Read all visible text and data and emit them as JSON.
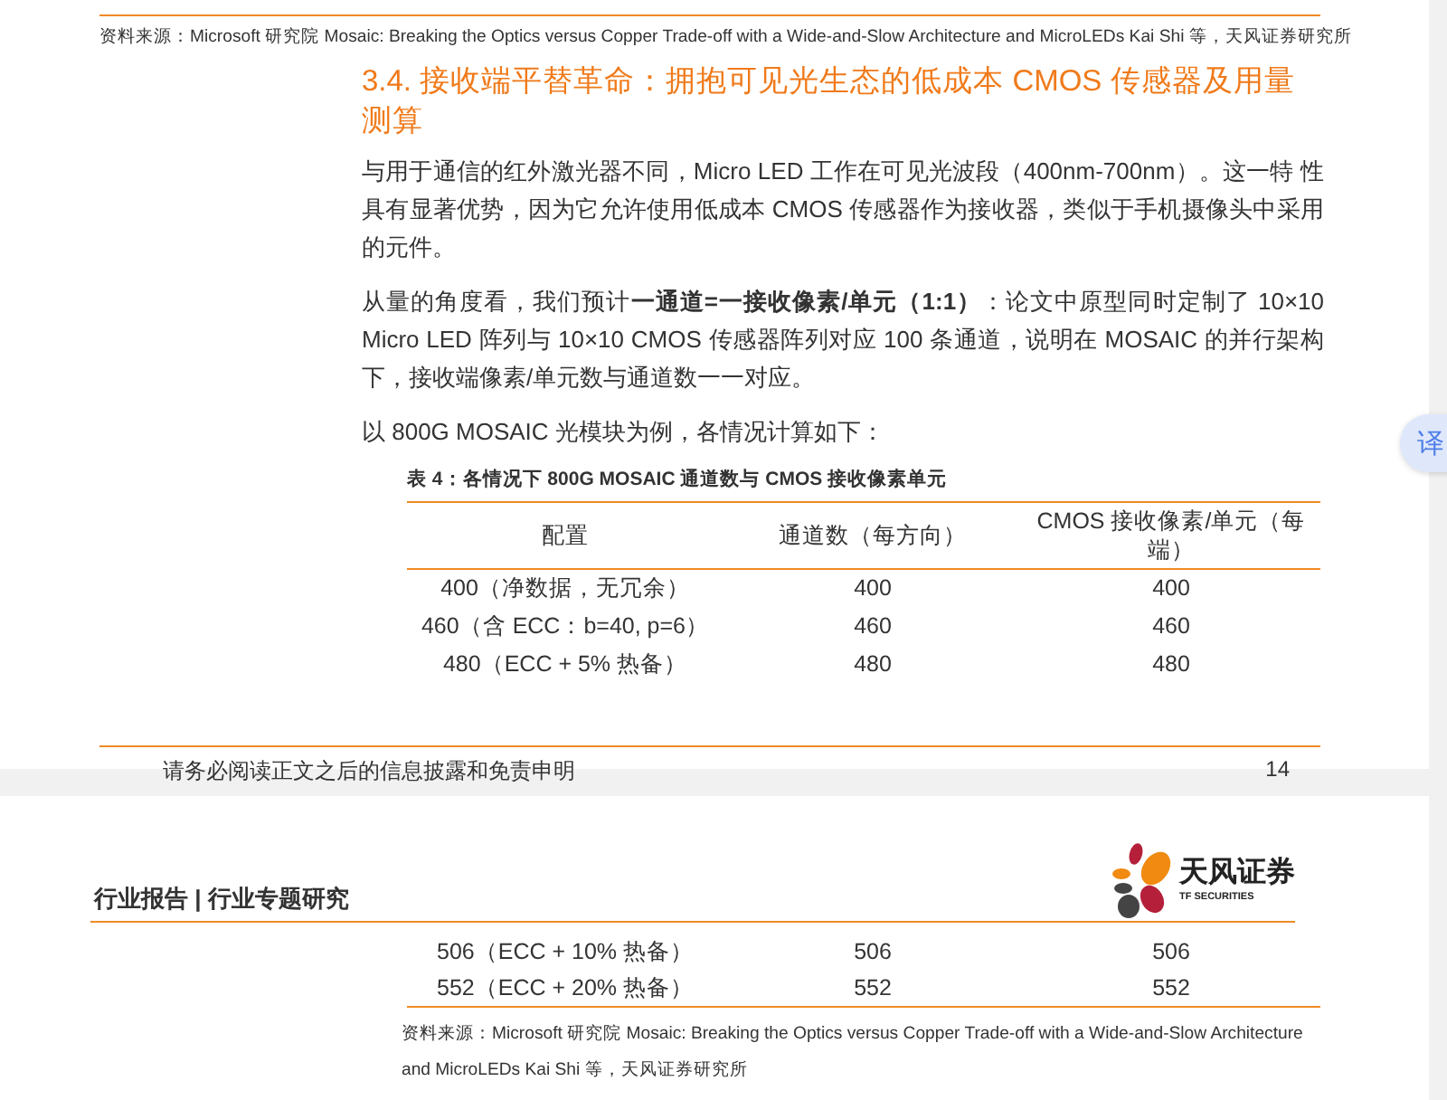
{
  "page_top": {
    "source_note": "资料来源：Microsoft 研究院 Mosaic:  Breaking the Optics versus Copper Trade-off with a Wide-and-Slow Architecture and MicroLEDs Kai Shi 等，天风证券研究所",
    "section_heading": "3.4. 接收端平替革命：拥抱可见光生态的低成本 CMOS 传感器及用量测算",
    "paragraphs": [
      "与用于通信的红外激光器不同，Micro  LED 工作在可见光波段（400nm-700nm）。这一特 性具有显著优势，因为它允许使用低成本 CMOS 传感器作为接收器，类似于手机摄像头中采用的元件。",
      "从量的角度看，我们预计**一通道=一接收像素/单元（1:1）**：论文中原型同时定制了 10×10 Micro LED 阵列与 10×10 CMOS 传感器阵列对应 100 条通道，说明在 MOSAIC 的并行架构下，接收端像素/单元数与通道数一一对应。",
      "以 800G MOSAIC 光模块为例，各情况计算如下："
    ],
    "table": {
      "caption": "表 4：各情况下 800G MOSAIC 通道数与 CMOS 接收像素单元",
      "columns": [
        "配置",
        "通道数（每方向）",
        "CMOS 接收像素/单元（每端）"
      ],
      "rows": [
        [
          "400（净数据，无冗余）",
          "400",
          "400"
        ],
        [
          "460（含 ECC：b=40, p=6）",
          "460",
          "460"
        ],
        [
          "480（ECC + 5% 热备）",
          "480",
          "480"
        ]
      ]
    },
    "footer": {
      "disclaimer": "请务必阅读正文之后的信息披露和免责申明",
      "page_number": "14"
    }
  },
  "page_next": {
    "header": {
      "title": "行业报告 | 行业专题研究",
      "logo_text": "天风证券",
      "logo_subtext": "TF SECURITIES"
    },
    "table_rows": [
      [
        "506（ECC + 10% 热备）",
        "506",
        "506"
      ],
      [
        "552（ECC + 20% 热备）",
        "552",
        "552"
      ]
    ],
    "source_note": "资料来源：Microsoft 研究院 Mosaic:  Breaking the Optics versus Copper Trade-off with a Wide-and-Slow Architecture and MicroLEDs Kai Shi 等，天风证券研究所"
  },
  "translate_button": {
    "label": "译"
  }
}
